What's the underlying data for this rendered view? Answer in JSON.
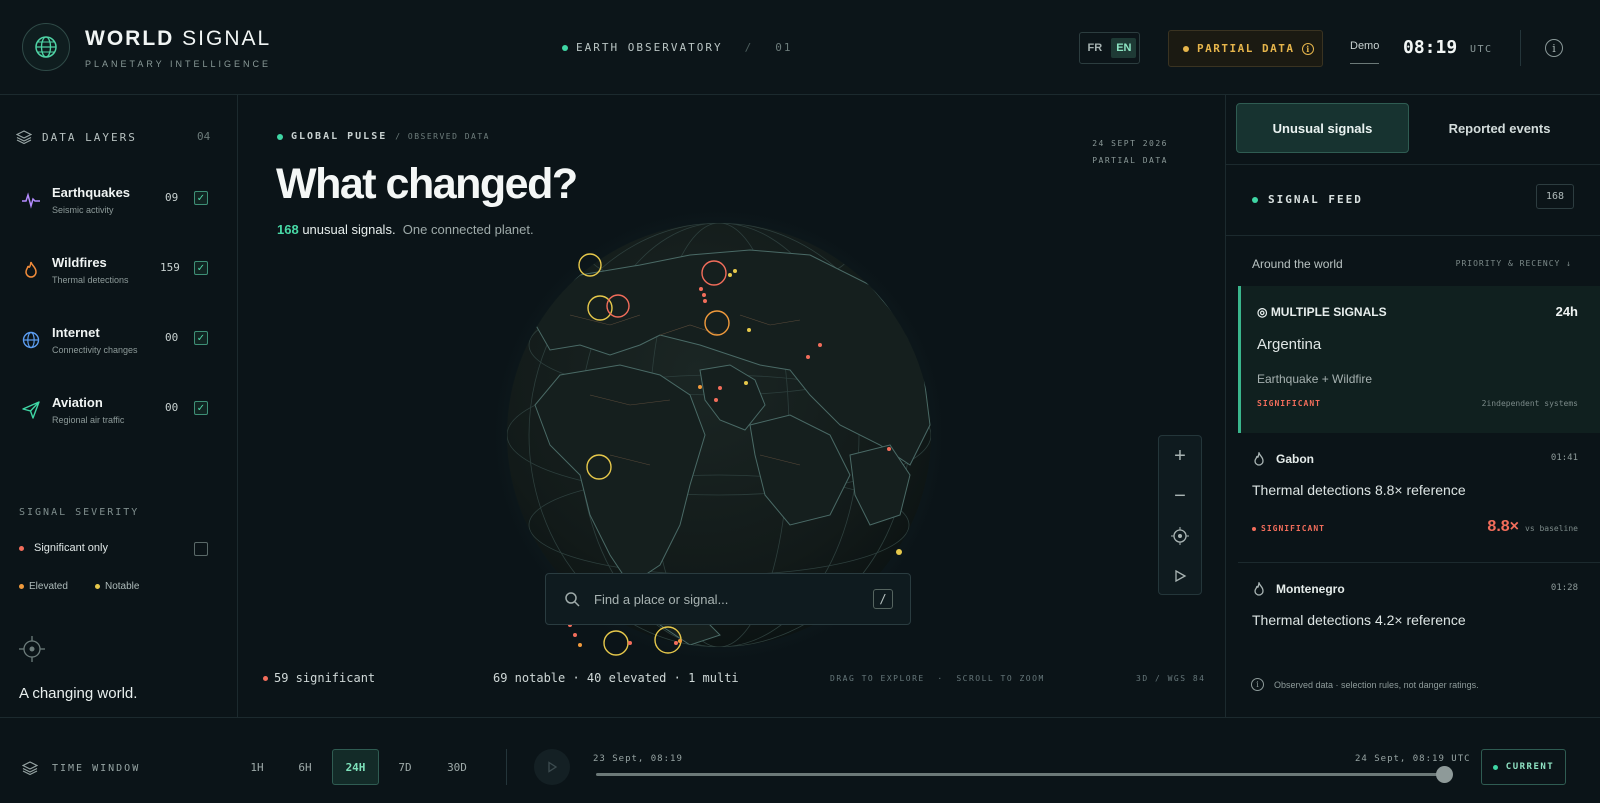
{
  "header": {
    "brand_bold": "WORLD",
    "brand_light": "SIGNAL",
    "tagline": "PLANETARY INTELLIGENCE",
    "observatory": "EARTH OBSERVATORY",
    "observatory_sep": "/",
    "observatory_num": "01",
    "lang_fr": "FR",
    "lang_en": "EN",
    "partial": "PARTIAL DATA",
    "mode": "Demo",
    "time": "08:19",
    "tz": "UTC"
  },
  "left": {
    "title": "DATA LAYERS",
    "count": "04",
    "layers": [
      {
        "name": "Earthquakes",
        "sub": "Seismic activity",
        "count": "09",
        "icon": "pulse-icon",
        "color": "#b58cff"
      },
      {
        "name": "Wildfires",
        "sub": "Thermal detections",
        "count": "159",
        "icon": "flame-icon",
        "color": "#f08b3a"
      },
      {
        "name": "Internet",
        "sub": "Connectivity changes",
        "count": "00",
        "icon": "globe-icon",
        "color": "#5c9df0"
      },
      {
        "name": "Aviation",
        "sub": "Regional air traffic",
        "count": "00",
        "icon": "plane-icon",
        "color": "#3fd6a4"
      }
    ],
    "severity_title": "SIGNAL SEVERITY",
    "significant_only": "Significant only",
    "elevated": "Elevated",
    "notable": "Notable",
    "changing": "A changing world."
  },
  "main": {
    "label": "GLOBAL PULSE",
    "label_sub": "/ OBSERVED DATA",
    "date": "24 SEPT 2026",
    "date_sub": "PARTIAL DATA",
    "headline": "What changed?",
    "count": "168",
    "count_text": "unusual signals.",
    "planet_text": "One connected planet.",
    "search_placeholder": "Find a place or signal...",
    "search_key": "/",
    "significant": "59 significant",
    "summary": "69 notable · 40 elevated · 1 multi",
    "hint": "DRAG TO EXPLORE  ·  SCROLL TO ZOOM",
    "proj": "3D / WGS 84"
  },
  "right": {
    "tab_active": "Unusual signals",
    "tab_other": "Reported events",
    "feed": "SIGNAL FEED",
    "feed_count": "168",
    "around": "Around the world",
    "sort": "PRIORITY & RECENCY",
    "multi": {
      "title": "MULTIPLE SIGNALS",
      "time": "24h",
      "place": "Argentina",
      "kinds": "Earthquake + Wildfire",
      "level": "SIGNIFICANT",
      "systems": "2independent systems"
    },
    "items": [
      {
        "name": "Gabon",
        "time": "01:41",
        "desc": "Thermal detections 8.8× reference",
        "level": "SIGNIFICANT",
        "mult": "8.8×",
        "baseline": "vs baseline"
      },
      {
        "name": "Montenegro",
        "time": "01:28",
        "desc": "Thermal detections 4.2× reference"
      }
    ],
    "footer": "Observed data · selection rules, not danger ratings."
  },
  "bottom": {
    "title": "TIME WINDOW",
    "ranges": [
      "1H",
      "6H",
      "24H",
      "7D",
      "30D"
    ],
    "active": "24H",
    "start": "23 Sept, 08:19",
    "end": "24 Sept, 08:19 UTC",
    "current": "CURRENT",
    "position": 1.0
  }
}
